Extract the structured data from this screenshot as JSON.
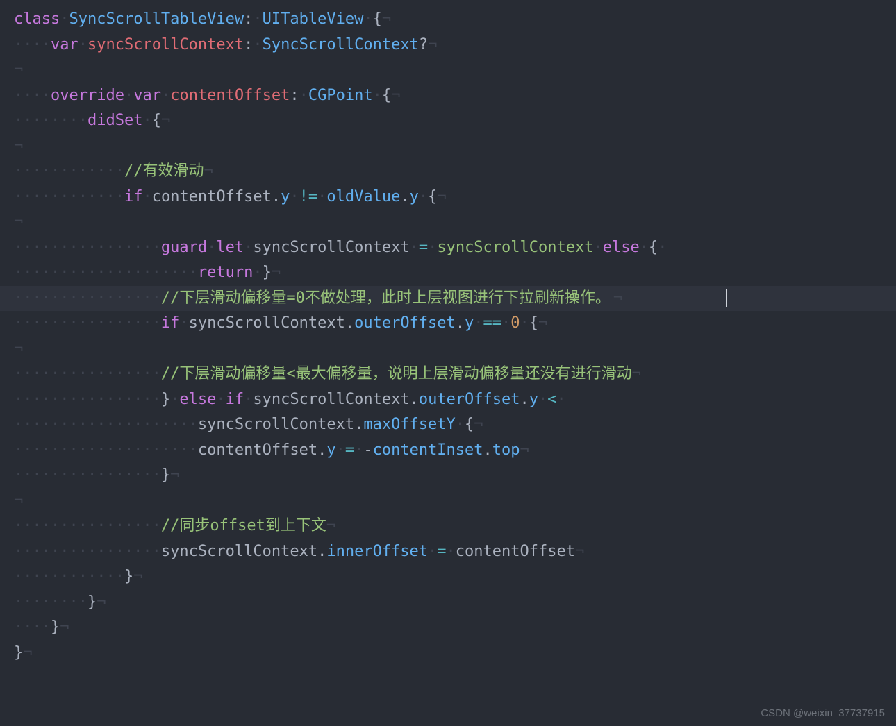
{
  "watermark": "CSDN @weixin_37737915",
  "ws": "·",
  "nl": "¬",
  "code": {
    "l1": {
      "class": "class",
      "sp1": "·",
      "name": "SyncScrollTableView",
      "colon": ":",
      "sp2": "·",
      "super": "UITableView",
      "sp3": "·",
      "br": "{"
    },
    "l2": {
      "ind": "····",
      "var": "var",
      "sp": "·",
      "id": "syncScrollContext",
      "colon": ":",
      "sp2": "·",
      "type": "SyncScrollContext",
      "q": "?"
    },
    "l3": {},
    "l4": {
      "ind": "····",
      "ov": "override",
      "sp": "·",
      "var": "var",
      "sp2": "·",
      "id": "contentOffset",
      "colon": ":",
      "sp3": "·",
      "type": "CGPoint",
      "sp4": "·",
      "br": "{"
    },
    "l5": {
      "ind": "········",
      "did": "didSet",
      "sp": "·",
      "br": "{"
    },
    "l6": {},
    "l7": {
      "ind": "············",
      "cmt": "//有效滑动"
    },
    "l8": {
      "ind": "············",
      "if": "if",
      "sp": "·",
      "a": "contentOffset",
      "dot": ".",
      "b": "y",
      "sp2": "·",
      "neq": "!=",
      "sp3": "·",
      "c": "oldValue",
      "dot2": ".",
      "d": "y",
      "sp4": "·",
      "br": "{"
    },
    "l9": {},
    "l10": {
      "ind": "················",
      "guard": "guard",
      "sp": "·",
      "let": "let",
      "sp2": "·",
      "id": "syncScrollContext",
      "sp3": "·",
      "eq": "=",
      "sp4": "·",
      "rhs": "syncScrollContext",
      "sp5": "·",
      "else": "else",
      "sp6": "·",
      "br": "{",
      "sp7": "·"
    },
    "l10b": {
      "ind2": "····················",
      "ret": "return",
      "sp": "·",
      "br": "}"
    },
    "l11": {
      "ind": "················",
      "cmt": "//下层滑动偏移量=0不做处理，此时上层视图进行下拉刷新操作。"
    },
    "l12": {
      "ind": "················",
      "if": "if",
      "sp": "·",
      "a": "syncScrollContext",
      "dot": ".",
      "b": "outerOffset",
      "dot2": ".",
      "c": "y",
      "sp2": "·",
      "eq": "==",
      "sp3": "·",
      "num": "0",
      "sp4": "·",
      "br": "{"
    },
    "l13": {},
    "l14": {
      "ind": "················",
      "cmt": "//下层滑动偏移量<最大偏移量，说明上层滑动偏移量还没有进行滑动"
    },
    "l15": {
      "ind": "················",
      "brc": "}",
      "sp": "·",
      "else": "else",
      "sp2": "·",
      "if": "if",
      "sp3": "·",
      "a": "syncScrollContext",
      "dot": ".",
      "b": "outerOffset",
      "dot2": ".",
      "c": "y",
      "sp4": "·",
      "lt": "<",
      "sp5": "·"
    },
    "l15b": {
      "ind2": "····················",
      "a": "syncScrollContext",
      "dot": ".",
      "b": "maxOffsetY",
      "sp": "·",
      "br": "{"
    },
    "l16": {
      "ind": "····················",
      "a": "contentOffset",
      "dot": ".",
      "b": "y",
      "sp": "·",
      "eq": "=",
      "sp2": "·",
      "neg": "-",
      "c": "contentInset",
      "dot2": ".",
      "d": "top"
    },
    "l17": {
      "ind": "················",
      "br": "}"
    },
    "l18": {},
    "l19": {
      "ind": "················",
      "cmt": "//同步offset到上下文"
    },
    "l20": {
      "ind": "················",
      "a": "syncScrollContext",
      "dot": ".",
      "b": "innerOffset",
      "sp": "·",
      "eq": "=",
      "sp2": "·",
      "c": "contentOffset"
    },
    "l21": {
      "ind": "············",
      "br": "}"
    },
    "l22": {
      "ind": "········",
      "br": "}"
    },
    "l23": {
      "ind": "····",
      "br": "}"
    },
    "l24": {
      "br": "}"
    }
  }
}
